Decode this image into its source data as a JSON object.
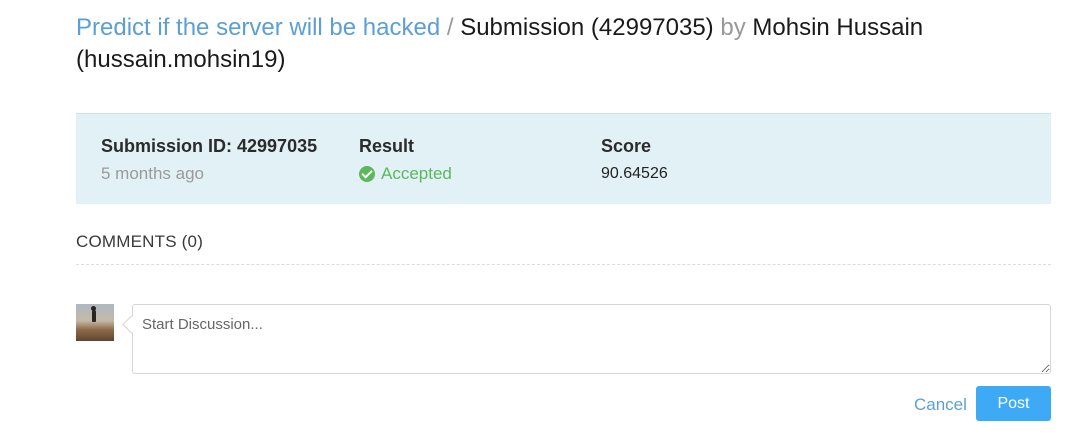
{
  "header": {
    "problem_link": "Predict if the server will be hacked",
    "separator": "/",
    "submission_text": "Submission (42997035)",
    "by_text": "by",
    "user_name": "Mohsin Hussain",
    "user_handle": "(hussain.mohsin19)"
  },
  "submission": {
    "id_label": "Submission ID: 42997035",
    "time_ago": "5 months ago",
    "result_label": "Result",
    "result_value": "Accepted",
    "result_icon": "check-circle-icon",
    "score_label": "Score",
    "score_value": "90.64526"
  },
  "comments": {
    "heading": "COMMENTS (0)",
    "input_placeholder": "Start Discussion...",
    "input_value": "",
    "cancel_label": "Cancel",
    "post_label": "Post"
  },
  "colors": {
    "link": "#5b9fd6",
    "info_background": "#e2f1f5",
    "accepted": "#5cb85c",
    "post_button": "#3ea9f5"
  }
}
